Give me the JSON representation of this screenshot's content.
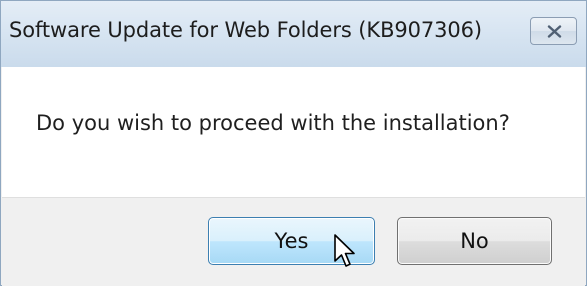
{
  "window": {
    "title": "Software Update for Web Folders (KB907306)",
    "close_icon": "close-icon"
  },
  "message": "Do you wish to proceed with the installation?",
  "buttons": {
    "yes_label": "Yes",
    "no_label": "No"
  },
  "cursor": {
    "icon": "arrow-pointer-icon"
  },
  "colors": {
    "titlebar": "#d8e5f2",
    "content_background": "#ffffff",
    "footer_background": "#f0f0f0",
    "default_button_border": "#3c7fb1",
    "default_button_fill": "#bee6fd"
  }
}
